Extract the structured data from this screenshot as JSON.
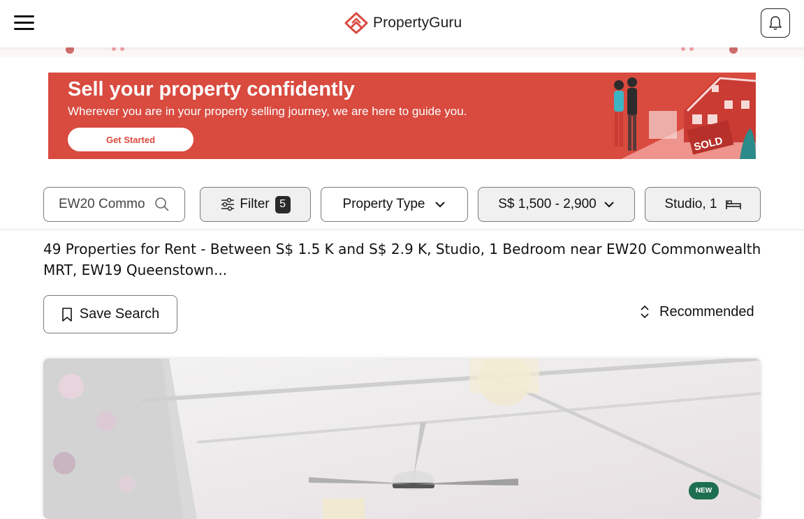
{
  "header": {
    "brand": "PropertyGuru",
    "menu_icon": "hamburger-menu-icon",
    "notification_icon": "bell-icon"
  },
  "banner": {
    "title": "Sell your property confidently",
    "subtitle": "Wherever you are in your property selling journey, we are here to guide you.",
    "cta": "Get Started",
    "sign_text": "SOLD",
    "background_color": "#d94a3f"
  },
  "filters": {
    "search_value": "EW20 Commo",
    "filter_label": "Filter",
    "filter_count": "5",
    "property_type_label": "Property Type",
    "price_label": "S$ 1,500 - 2,900",
    "bedrooms_label": "Studio, 1"
  },
  "results": {
    "title": "49 Properties for Rent - Between S$ 1.5 K and S$ 2.9 K, Studio, 1 Bedroom near EW20 Commonwealth MRT, EW19 Queenstown...",
    "save_search_label": "Save Search",
    "sort_label": "Recommended"
  },
  "listing": {
    "badge": "NEW"
  },
  "colors": {
    "brand_red": "#d94a3f",
    "badge_green": "#1e6f4f"
  }
}
